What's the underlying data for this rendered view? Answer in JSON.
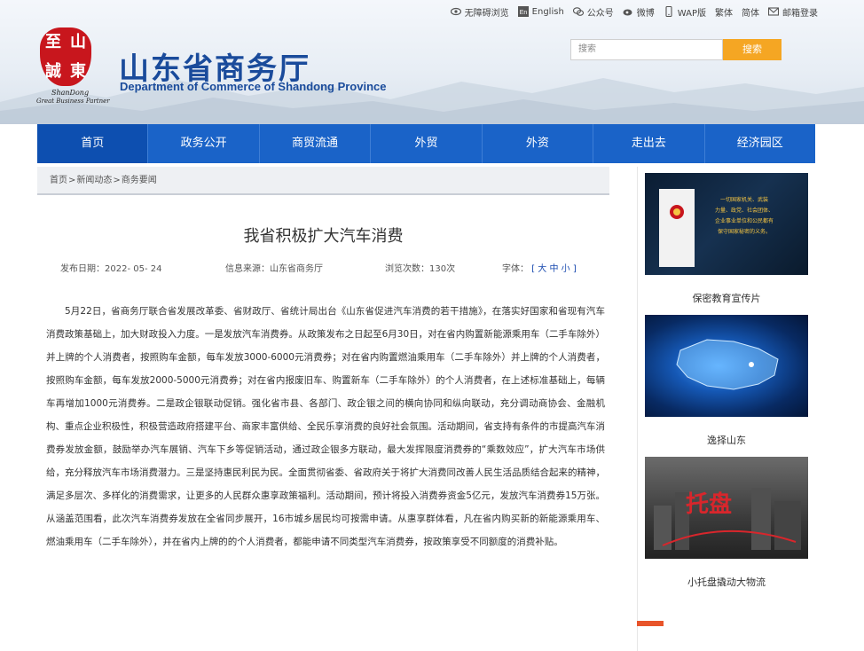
{
  "topbar": {
    "accessible": "无障碍浏览",
    "english": "English",
    "wechat_public": "公众号",
    "weibo": "微博",
    "wap": "WAP版",
    "traditional": "繁体",
    "simplified": "简体",
    "mail": "邮箱登录"
  },
  "logo": {
    "seal_chars": [
      "至",
      "山",
      "誠",
      "東"
    ],
    "caption1": "ShanDong",
    "caption2": "Great Business Partner"
  },
  "site": {
    "title": "山东省商务厅",
    "subtitle": "Department of Commerce of Shandong Province"
  },
  "search": {
    "placeholder": "搜索",
    "button": "搜索"
  },
  "nav": [
    "首页",
    "政务公开",
    "商贸流通",
    "外贸",
    "外资",
    "走出去",
    "经济园区"
  ],
  "breadcrumb": [
    "首页",
    "新闻动态",
    "商务要闻"
  ],
  "article": {
    "title": "我省积极扩大汽车消费",
    "publish_label": "发布日期：",
    "publish_date": "2022- 05- 24",
    "source_label": "信息来源：",
    "source": "山东省商务厅",
    "views_label": "浏览次数：",
    "views": "130次",
    "font_label": "字体：",
    "font_open": "[",
    "font_large": "大",
    "font_medium": "中",
    "font_small": "小",
    "font_close": "]",
    "body": "5月22日，省商务厅联合省发展改革委、省财政厅、省统计局出台《山东省促进汽车消费的若干措施》，在落实好国家和省现有汽车消费政策基础上，加大财政投入力度。一是发放汽车消费券。从政策发布之日起至6月30日，对在省内购置新能源乘用车（二手车除外）并上牌的个人消费者，按照购车金额，每车发放3000-6000元消费券；对在省内购置燃油乘用车（二手车除外）并上牌的个人消费者，按照购车金额，每车发放2000-5000元消费券；对在省内报废旧车、购置新车（二手车除外）的个人消费者，在上述标准基础上，每辆车再增加1000元消费券。二是政企银联动促销。强化省市县、各部门、政企银之间的横向协同和纵向联动，充分调动商协会、金融机构、重点企业积极性，积极营造政府搭建平台、商家丰富供给、全民乐享消费的良好社会氛围。活动期间，省支持有条件的市提高汽车消费券发放金额，鼓励举办汽车展销、汽车下乡等促销活动，通过政企银多方联动，最大发挥限度消费券的“乘数效应”，扩大汽车市场供给，充分释放汽车市场消费潜力。三是坚持惠民利民为民。全面贯彻省委、省政府关于将扩大消费同改善人民生活品质结合起来的精神，满足多层次、多样化的消费需求，让更多的人民群众惠享政策福利。活动期间，预计将投入消费券资金5亿元，发放汽车消费券15万张。从涵盖范围看，此次汽车消费券发放在全省同步展开，16市城乡居民均可按需申请。从惠享群体看，凡在省内购买新的新能源乘用车、燃油乘用车（二手车除外），并在省内上牌的的个人消费者，都能申请不同类型汽车消费券，按政策享受不同额度的消费补贴。"
  },
  "sidebar": {
    "cards": [
      {
        "caption": "保密教育宣传片",
        "pic_text": "一切国家机关、武装力量、政党、社会团体、企业事业单位和公民都有保守国家秘密的义务。"
      },
      {
        "caption": "逸择山东"
      },
      {
        "caption": "小托盘撬动大物流",
        "pic_text": "托盘"
      }
    ]
  }
}
